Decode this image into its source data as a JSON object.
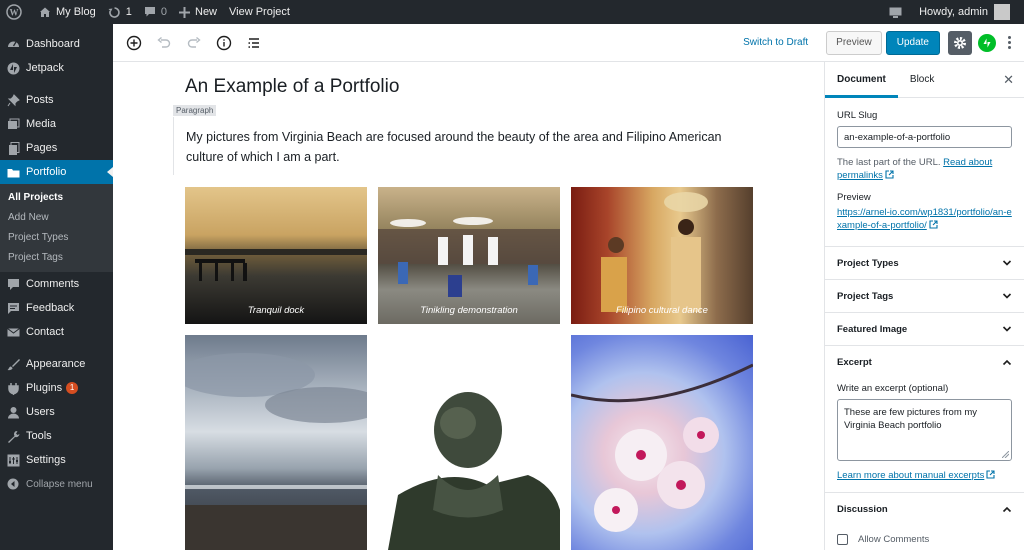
{
  "adminbar": {
    "site_name": "My Blog",
    "updates_count": "1",
    "comments_count": "0",
    "new_label": "New",
    "view_label": "View Project",
    "howdy": "Howdy, admin"
  },
  "sidebar": {
    "items": [
      {
        "label": "Dashboard",
        "icon": "dashboard-icon"
      },
      {
        "label": "Jetpack",
        "icon": "jetpack-icon"
      },
      {
        "label": "Posts",
        "icon": "pin-icon"
      },
      {
        "label": "Media",
        "icon": "media-icon"
      },
      {
        "label": "Pages",
        "icon": "pages-icon"
      },
      {
        "label": "Portfolio",
        "icon": "folder-icon"
      },
      {
        "label": "Comments",
        "icon": "comment-icon"
      },
      {
        "label": "Feedback",
        "icon": "feedback-icon"
      },
      {
        "label": "Contact",
        "icon": "mail-icon"
      },
      {
        "label": "Appearance",
        "icon": "brush-icon"
      },
      {
        "label": "Plugins",
        "icon": "plug-icon",
        "badge": "1"
      },
      {
        "label": "Users",
        "icon": "user-icon"
      },
      {
        "label": "Tools",
        "icon": "wrench-icon"
      },
      {
        "label": "Settings",
        "icon": "settings-icon"
      },
      {
        "label": "Collapse menu",
        "icon": "collapse-icon"
      }
    ],
    "submenu": [
      "All Projects",
      "Add New",
      "Project Types",
      "Project Tags"
    ]
  },
  "toolbar": {
    "switch_draft": "Switch to Draft",
    "preview": "Preview",
    "update": "Update"
  },
  "post": {
    "title": "An Example of a Portfolio",
    "block_label": "Paragraph",
    "paragraph": "My pictures from Virginia Beach are focused around the beauty of the area and Filipino American culture of which I am a part."
  },
  "gallery": {
    "captions": [
      "Tranquil dock",
      "Tinikling demonstration",
      "Filipino cultural dance"
    ]
  },
  "settings": {
    "tab_document": "Document",
    "tab_block": "Block",
    "url_slug_label": "URL Slug",
    "url_slug_value": "an-example-of-a-portfolio",
    "url_help": "The last part of the URL. ",
    "url_help_link": "Read about permalinks",
    "preview_label": "Preview",
    "preview_url": "https://arnel-io.com/wp1831/portfolio/an-example-of-a-portfolio/",
    "project_types": "Project Types",
    "project_tags": "Project Tags",
    "featured_image": "Featured Image",
    "excerpt": "Excerpt",
    "excerpt_label": "Write an excerpt (optional)",
    "excerpt_value": "These are few pictures from my Virginia Beach portfolio",
    "excerpt_link": "Learn more about manual excerpts",
    "discussion": "Discussion",
    "allow_comments": "Allow Comments"
  }
}
